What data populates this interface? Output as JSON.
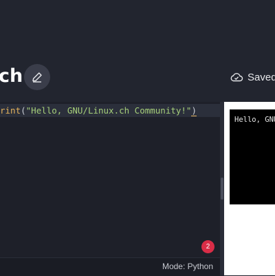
{
  "header": {
    "title": "ch",
    "save_status": "Saved"
  },
  "editor": {
    "code": {
      "fn_visible": "rint",
      "open_paren": "(",
      "string": "\"Hello, GNU/Linux.ch Community!\"",
      "close_paren": ")"
    },
    "error_count": "2",
    "mode_label": "Mode: Python"
  },
  "output": {
    "text": "Hello, GNU/Linux.ch Community!"
  },
  "icons": {
    "edit": "pencil-icon",
    "saved": "cloud-check-icon"
  },
  "colors": {
    "error_badge": "#d92d47",
    "function": "#e5b35c",
    "string": "#a6cf7a"
  }
}
